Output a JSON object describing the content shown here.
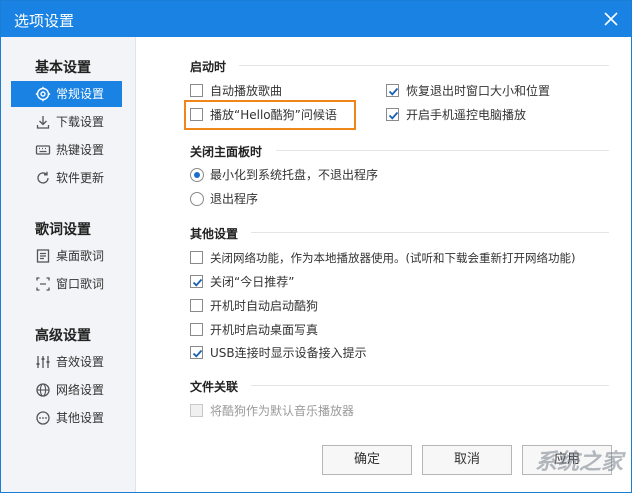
{
  "window": {
    "title": "选项设置"
  },
  "sidebar": {
    "groups": [
      {
        "title": "基本设置",
        "items": [
          {
            "label": "常规设置",
            "icon": "gear-icon",
            "active": true
          },
          {
            "label": "下载设置",
            "icon": "download-icon"
          },
          {
            "label": "热键设置",
            "icon": "keyboard-icon"
          },
          {
            "label": "软件更新",
            "icon": "refresh-icon"
          }
        ]
      },
      {
        "title": "歌词设置",
        "items": [
          {
            "label": "桌面歌词",
            "icon": "desktop-lyrics-icon"
          },
          {
            "label": "窗口歌词",
            "icon": "window-lyrics-icon"
          }
        ]
      },
      {
        "title": "高级设置",
        "items": [
          {
            "label": "音效设置",
            "icon": "equalizer-icon"
          },
          {
            "label": "网络设置",
            "icon": "globe-icon"
          },
          {
            "label": "其他设置",
            "icon": "more-icon"
          }
        ]
      }
    ]
  },
  "sections": {
    "startup": {
      "title": "启动时",
      "options": [
        {
          "label": "自动播放歌曲",
          "checked": false
        },
        {
          "label": "恢复退出时窗口大小和位置",
          "checked": true
        },
        {
          "label": "播放“Hello酷狗”问候语",
          "checked": false
        },
        {
          "label": "开启手机遥控电脑播放",
          "checked": true
        }
      ]
    },
    "close_panel": {
      "title": "关闭主面板时",
      "options": [
        {
          "label": "最小化到系统托盘，不退出程序",
          "selected": true
        },
        {
          "label": "退出程序",
          "selected": false
        }
      ]
    },
    "other": {
      "title": "其他设置",
      "options": [
        {
          "label": "关闭网络功能，作为本地播放器使用。(试听和下载会重新打开网络功能)",
          "checked": false
        },
        {
          "label": "关闭“今日推荐”",
          "checked": true
        },
        {
          "label": "开机时自动启动酷狗",
          "checked": false
        },
        {
          "label": "开机时启动桌面写真",
          "checked": false
        },
        {
          "label": "USB连接时显示设备接入提示",
          "checked": true
        }
      ]
    },
    "file_assoc": {
      "title": "文件关联",
      "options": [
        {
          "label": "将酷狗作为默认音乐播放器",
          "checked": false,
          "disabled": true
        }
      ]
    }
  },
  "buttons": {
    "ok": "确定",
    "cancel": "取消",
    "apply": "应用"
  },
  "watermark": "系统之家",
  "colors": {
    "accent": "#1a82e2",
    "highlight": "#f08519"
  }
}
